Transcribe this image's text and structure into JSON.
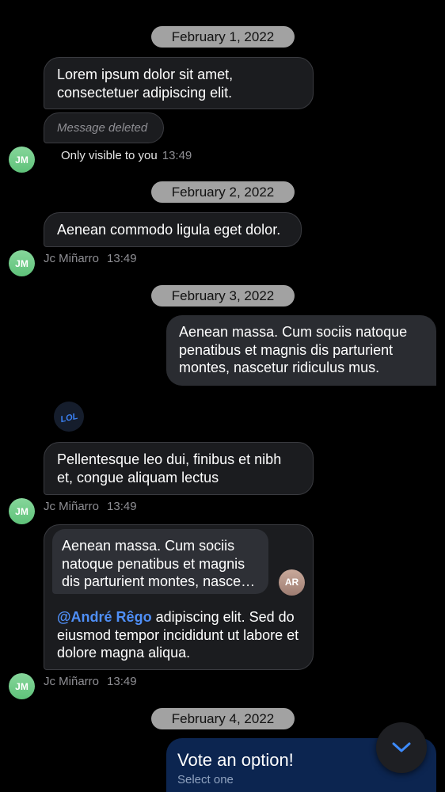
{
  "messages": {
    "date1": "February 1, 2022",
    "m1": "Lorem ipsum dolor sit amet, consectetuer adipiscing elit.",
    "deleted_label": "Message deleted",
    "m1_note": "Only visible to you",
    "m1_time": "13:49",
    "avatar_initials": "JM",
    "date2": "February 2, 2022",
    "m2": "Aenean commodo ligula eget dolor.",
    "m2_author": "Jc Miñarro",
    "m2_time": "13:49",
    "date3": "February 3, 2022",
    "m3": "Aenean massa. Cum sociis natoque penatibus et magnis dis parturient montes, nascetur ridiculus mus.",
    "reaction_label": "LOL",
    "m4": "Pellentesque leo dui, finibus et nibh et, congue aliquam lectus",
    "m4_author": "Jc Miñarro",
    "m4_time": "13:49",
    "quote_text": "Aenean massa. Cum sociis natoque penatibus et magnis dis parturient montes, nascetur ridiculus mus.",
    "quote_avatar": "AR",
    "m5_mention": "@André Rêgo",
    "m5_text": " adipiscing elit. Sed do eiusmod tempor incididunt ut labore et dolore magna aliqua.",
    "m5_author": "Jc Miñarro",
    "m5_time": "13:49",
    "date4": "February 4, 2022"
  },
  "poll": {
    "title": "Vote an option!",
    "subtitle": "Select one"
  },
  "icons": {
    "scroll_down": "chevron-down-icon",
    "reaction": "lol-reaction-icon"
  },
  "colors": {
    "background": "#000000",
    "bubble": "#1b1c1f",
    "accent": "#4f8ff7",
    "poll": "#0c2550",
    "avatar_jm": "#6fcf8a"
  }
}
